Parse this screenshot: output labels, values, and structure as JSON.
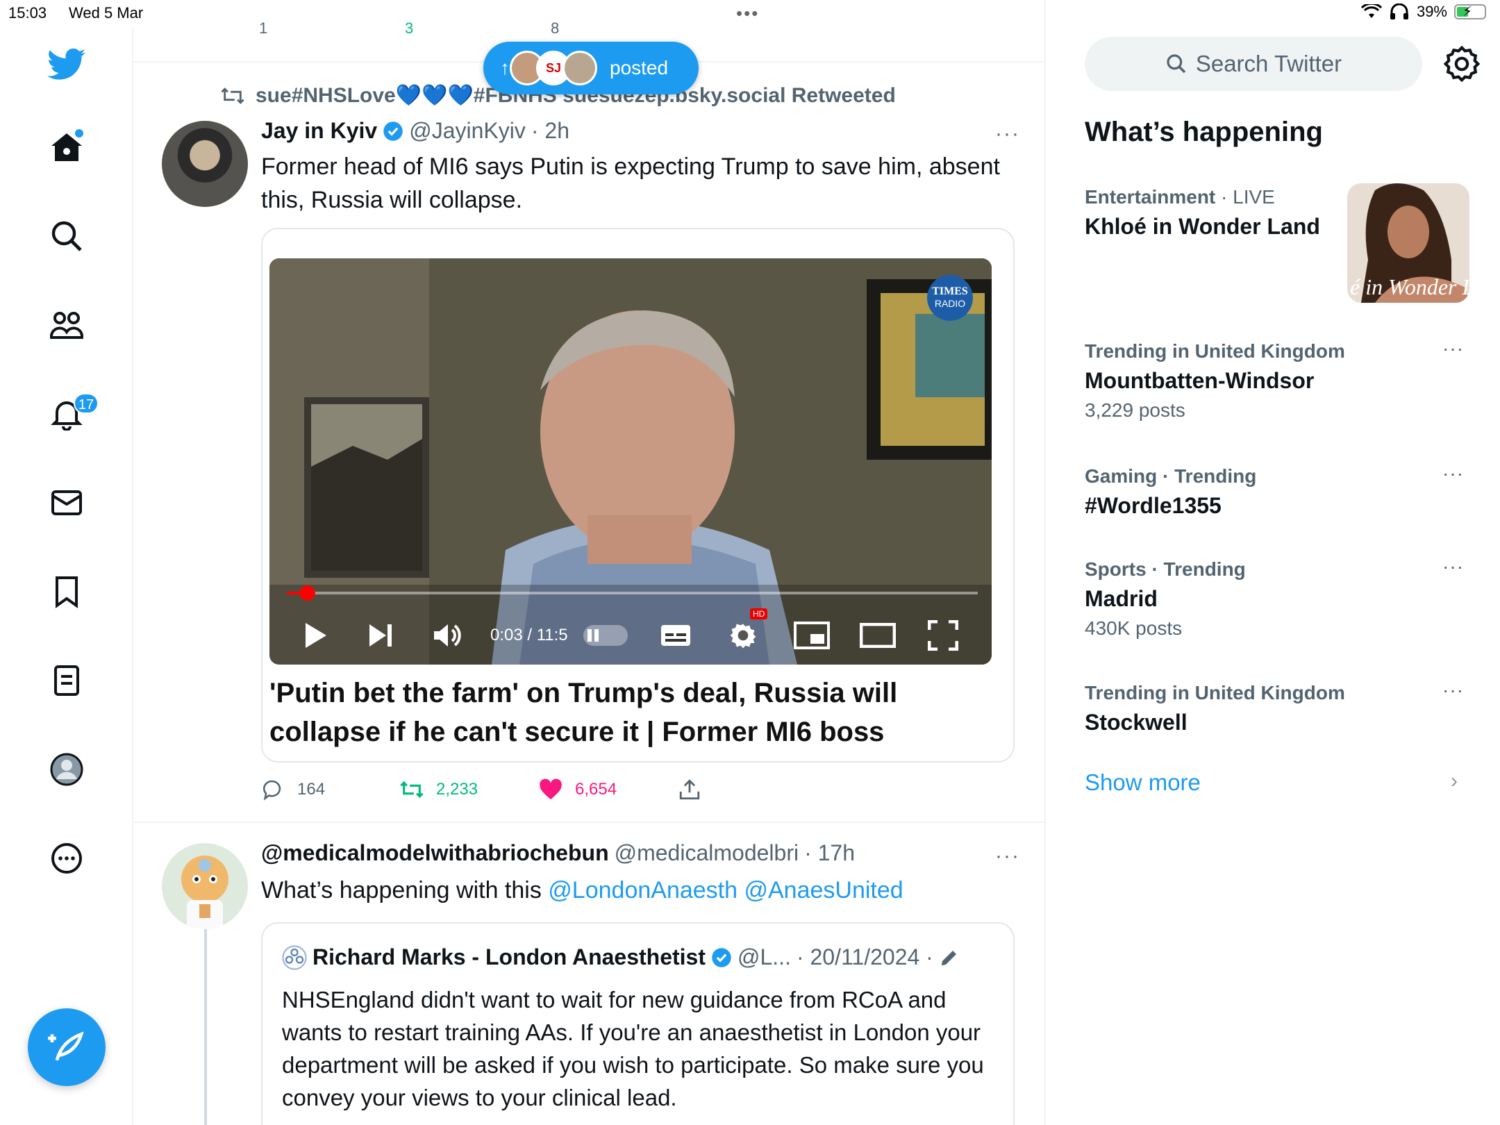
{
  "status_bar": {
    "time": "15:03",
    "date": "Wed 5 Mar",
    "battery": "39%"
  },
  "nav": {
    "notifications_badge": "17"
  },
  "timeline": {
    "prev_actions": {
      "replies": "1",
      "retweets": "3",
      "likes": "8"
    },
    "posted_pill": {
      "label": "posted"
    },
    "tweet1": {
      "retweeted_by": "sue#NHSLove💙💙💙#FBNHS suesuezep.bsky.social Retweeted",
      "name": "Jay in Kyiv",
      "handle": "@JayinKyiv",
      "time": "· 2h",
      "text": "Former head of MI6 says Putin is expecting Trump to save him, absent this, Russia will collapse.",
      "card": {
        "title": "'Putin bet the farm' on Trump's deal, Russia will collapse if he can't secure it | Former MI6 boss",
        "video_time": "0:03 / 11:5",
        "watermark_line1": "TIMES",
        "watermark_line2": "RADIO",
        "hd_label": "HD",
        "progress": 0.03
      },
      "actions": {
        "replies": "164",
        "retweets": "2,233",
        "likes": "6,654"
      }
    },
    "tweet2": {
      "name": "@medicalmodelwithabriochebun",
      "handle": "@medicalmodelbri",
      "time": "· 17h",
      "text_prefix": "What’s happening with this",
      "mention1": "@LondonAnaesth",
      "mention2": "@AnaesUnited",
      "quote": {
        "name": "Richard Marks - London Anaesthetist",
        "handle": "@L...",
        "time": "· 20/11/2024 ·",
        "text": "NHSEngland didn't want to wait for new guidance from RCoA and wants to restart training AAs. If you're an anaesthetist in London your department will be asked if you wish to participate. So make sure you convey your views to your clinical lead."
      }
    }
  },
  "sidebar": {
    "search_placeholder": "Search Twitter",
    "section_title": "What’s happening",
    "trends": [
      {
        "category": "Entertainment",
        "qualifier": "· LIVE",
        "title": "Khloé in Wonder Land",
        "count": "",
        "image_caption": "é in Wonder L"
      },
      {
        "category": "Trending in United Kingdom",
        "qualifier": "",
        "title": "Mountbatten-Windsor",
        "count": "3,229 posts"
      },
      {
        "category": "Gaming · Trending",
        "qualifier": "",
        "title": "#Wordle1355",
        "count": ""
      },
      {
        "category": "Sports · Trending",
        "qualifier": "",
        "title": "Madrid",
        "count": "430K posts"
      },
      {
        "category": "Trending in United Kingdom",
        "qualifier": "",
        "title": "Stockwell",
        "count": ""
      }
    ],
    "show_more": "Show more"
  },
  "colors": {
    "accent": "#1d9bf0",
    "retweet": "#00ba7c",
    "like": "#f91880",
    "secondary_text": "#536471"
  }
}
